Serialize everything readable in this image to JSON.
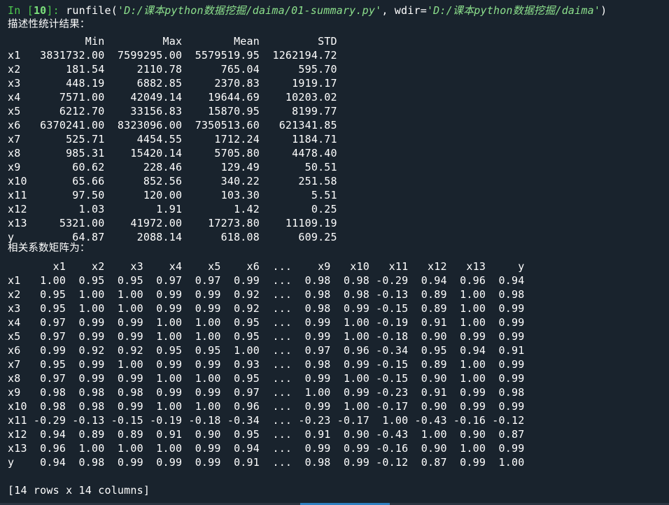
{
  "prompt": {
    "in_label": "In [",
    "number": "10",
    "close": "]: ",
    "cmd_a": "runfile(",
    "path": "'D:/课本python数据挖掘/daima/01-summary.py'",
    "cmd_b": ", wdir=",
    "wdir": "'D:/课本python数据挖掘/daima'",
    "cmd_c": ")"
  },
  "summary": {
    "title": "描述性统计结果：",
    "header": "            Min         Max        Mean         STD",
    "rows": [
      "x1   3831732.00  7599295.00  5579519.95  1262194.72",
      "x2       181.54     2110.78      765.04      595.70",
      "x3       448.19     6882.85     2370.83     1919.17",
      "x4      7571.00    42049.14    19644.69    10203.02",
      "x5      6212.70    33156.83    15870.95     8199.77",
      "x6   6370241.00  8323096.00  7350513.60   621341.85",
      "x7       525.71     4454.55     1712.24     1184.71",
      "x8       985.31    15420.14     5705.80     4478.40",
      "x9        60.62      228.46      129.49       50.51",
      "x10       65.66      852.56      340.22      251.58",
      "x11       97.50      120.00      103.30        5.51",
      "x12        1.03        1.91        1.42        0.25",
      "x13     5321.00    41972.00    17273.80    11109.19",
      "y         64.87     2088.14      618.08      609.25"
    ]
  },
  "correlation": {
    "title": "相关系数矩阵为：",
    "header": "       x1    x2    x3    x4    x5    x6  ...    x9   x10   x11   x12   x13     y",
    "rows": [
      "x1   1.00  0.95  0.95  0.97  0.97  0.99  ...  0.98  0.98 -0.29  0.94  0.96  0.94",
      "x2   0.95  1.00  1.00  0.99  0.99  0.92  ...  0.98  0.98 -0.13  0.89  1.00  0.98",
      "x3   0.95  1.00  1.00  0.99  0.99  0.92  ...  0.98  0.99 -0.15  0.89  1.00  0.99",
      "x4   0.97  0.99  0.99  1.00  1.00  0.95  ...  0.99  1.00 -0.19  0.91  1.00  0.99",
      "x5   0.97  0.99  0.99  1.00  1.00  0.95  ...  0.99  1.00 -0.18  0.90  0.99  0.99",
      "x6   0.99  0.92  0.92  0.95  0.95  1.00  ...  0.97  0.96 -0.34  0.95  0.94  0.91",
      "x7   0.95  0.99  1.00  0.99  0.99  0.93  ...  0.98  0.99 -0.15  0.89  1.00  0.99",
      "x8   0.97  0.99  0.99  1.00  1.00  0.95  ...  0.99  1.00 -0.15  0.90  1.00  0.99",
      "x9   0.98  0.98  0.98  0.99  0.99  0.97  ...  1.00  0.99 -0.23  0.91  0.99  0.98",
      "x10  0.98  0.98  0.99  1.00  1.00  0.96  ...  0.99  1.00 -0.17  0.90  0.99  0.99",
      "x11 -0.29 -0.13 -0.15 -0.19 -0.18 -0.34  ... -0.23 -0.17  1.00 -0.43 -0.16 -0.12",
      "x12  0.94  0.89  0.89  0.91  0.90  0.95  ...  0.91  0.90 -0.43  1.00  0.90  0.87",
      "x13  0.96  1.00  1.00  1.00  0.99  0.94  ...  0.99  0.99 -0.16  0.90  1.00  0.99",
      "y    0.94  0.98  0.99  0.99  0.99  0.91  ...  0.98  0.99 -0.12  0.87  0.99  1.00"
    ],
    "footer": "[14 rows x 14 columns]"
  },
  "colors": {
    "background": "#19232d",
    "prompt": "#4ec94e",
    "string": "#8ce08c",
    "scrollbar": "#2f7fbf"
  }
}
